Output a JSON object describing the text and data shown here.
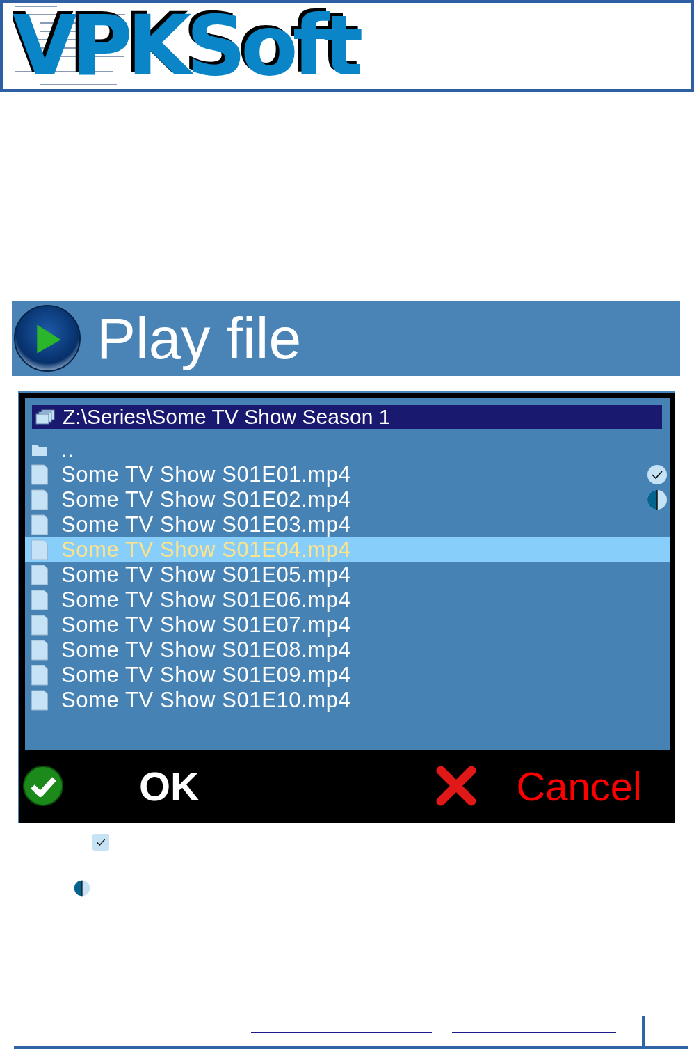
{
  "header": {
    "logo": "VPKSoft"
  },
  "dialog": {
    "title": "Play file",
    "path": "Z:\\Series\\Some TV Show Season 1",
    "items": [
      {
        "kind": "folder",
        "name": "..",
        "selected": false,
        "watched": false,
        "partially_watched": false
      },
      {
        "kind": "file",
        "name": "Some TV Show S01E01.mp4",
        "selected": false,
        "watched": true,
        "partially_watched": false
      },
      {
        "kind": "file",
        "name": "Some TV Show S01E02.mp4",
        "selected": false,
        "watched": false,
        "partially_watched": true
      },
      {
        "kind": "file",
        "name": "Some TV Show S01E03.mp4",
        "selected": false,
        "watched": false,
        "partially_watched": false
      },
      {
        "kind": "file",
        "name": "Some TV Show S01E04.mp4",
        "selected": true,
        "watched": false,
        "partially_watched": false
      },
      {
        "kind": "file",
        "name": "Some TV Show S01E05.mp4",
        "selected": false,
        "watched": false,
        "partially_watched": false
      },
      {
        "kind": "file",
        "name": "Some TV Show S01E06.mp4",
        "selected": false,
        "watched": false,
        "partially_watched": false
      },
      {
        "kind": "file",
        "name": "Some TV Show S01E07.mp4",
        "selected": false,
        "watched": false,
        "partially_watched": false
      },
      {
        "kind": "file",
        "name": "Some TV Show S01E08.mp4",
        "selected": false,
        "watched": false,
        "partially_watched": false
      },
      {
        "kind": "file",
        "name": "Some TV Show S01E09.mp4",
        "selected": false,
        "watched": false,
        "partially_watched": false
      },
      {
        "kind": "file",
        "name": "Some TV Show S01E10.mp4",
        "selected": false,
        "watched": false,
        "partially_watched": false
      }
    ],
    "buttons": [
      {
        "kind": "ok",
        "label": "OK"
      },
      {
        "kind": "cancel",
        "label": "Cancel"
      }
    ]
  },
  "legend": [
    {
      "kind": "watched"
    },
    {
      "kind": "partial"
    }
  ]
}
